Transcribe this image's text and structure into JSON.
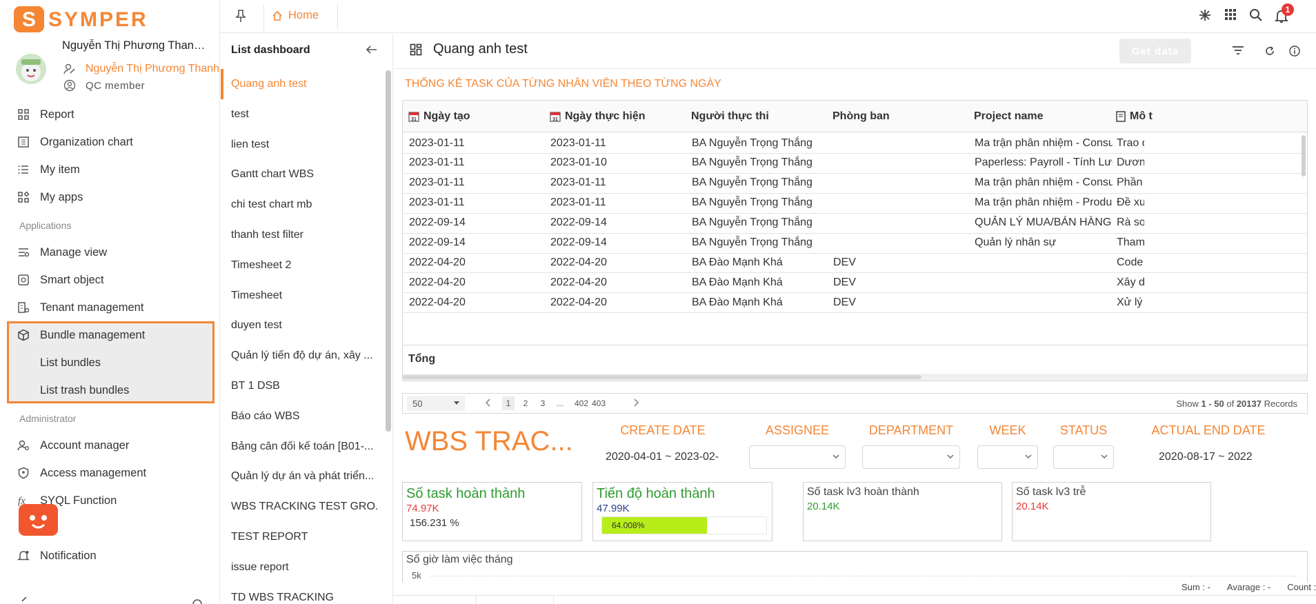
{
  "brand": {
    "logo_text": "SYMPER",
    "accent": "#f58634"
  },
  "user": {
    "name": "Nguyễn Thị Phương Thanh ...",
    "display_name": "Nguyễn Thị Phương Thanh",
    "role": "QC member"
  },
  "nav": {
    "items_top": [
      {
        "label": "Report",
        "icon": "report-icon"
      },
      {
        "label": "Organization chart",
        "icon": "org-chart-icon"
      },
      {
        "label": "My item",
        "icon": "list-icon"
      },
      {
        "label": "My apps",
        "icon": "apps-icon"
      }
    ],
    "section_applications": "Applications",
    "items_apps": [
      {
        "label": "Manage view",
        "icon": "manage-view-icon"
      },
      {
        "label": "Smart object",
        "icon": "smart-object-icon"
      },
      {
        "label": "Tenant management",
        "icon": "tenant-icon"
      },
      {
        "label": "Bundle management",
        "icon": "cube-icon"
      },
      {
        "label": "List bundles"
      },
      {
        "label": "List trash bundles"
      }
    ],
    "section_admin": "Administrator",
    "items_admin": [
      {
        "label": "Account manager",
        "icon": "account-icon"
      },
      {
        "label": "Access management",
        "icon": "shield-icon"
      },
      {
        "label": "SYQL Function",
        "icon": "function-icon"
      },
      {
        "label": "Notification",
        "icon": "bell-icon"
      }
    ]
  },
  "topbar": {
    "home_label": "Home",
    "notification_count": "1"
  },
  "list_dashboard": {
    "title": "List dashboard",
    "items": [
      "Quang anh test",
      "test",
      "lien test",
      "Gantt chart WBS",
      "chi test chart mb",
      "thanh test filter",
      "Timesheet 2",
      "Timesheet",
      "duyen test",
      "Quản lý tiến độ dự án, xây ...",
      "BT 1 DSB",
      "Báo cáo WBS",
      "Bảng cân đối kế toán [B01-...",
      "Quản lý dự án và phát triển...",
      "WBS TRACKING TEST GRO...",
      "TEST REPORT",
      "issue report",
      "TD WBS TRACKING"
    ]
  },
  "main": {
    "title": "Quang anh test",
    "get_data_label": "Get data",
    "table_title": "THỐNG KÊ TASK CỦA TỪNG NHÂN VIÊN THEO TỪNG NGÀY",
    "columns": [
      "Ngày tạo",
      "Ngày thực hiện",
      "Người thực thi",
      "Phòng ban",
      "Project name",
      "Mô t"
    ],
    "rows": [
      [
        "2023-01-11",
        "2023-01-11",
        "BA Nguyễn Trọng Thắng",
        "",
        "Ma trận phân nhiệm - Consulta...",
        "Trao đ"
      ],
      [
        "2023-01-11",
        "2023-01-10",
        "BA Nguyễn Trọng Thắng",
        "",
        "Paperless: Payroll - Tính Lương",
        "Dương"
      ],
      [
        "2023-01-11",
        "2023-01-11",
        "BA Nguyễn Trọng Thắng",
        "",
        "Ma trận phân nhiệm - Consulta...",
        "Phần l"
      ],
      [
        "2023-01-11",
        "2023-01-11",
        "BA Nguyễn Trọng Thắng",
        "",
        "Ma trận phân nhiệm - Product ...",
        "Đề xuấ"
      ],
      [
        "2022-09-14",
        "2022-09-14",
        "BA Nguyễn Trọng Thắng",
        "",
        "QUẢN LÝ MUA/BÁN HÀNG",
        "Rà soá"
      ],
      [
        "2022-09-14",
        "2022-09-14",
        "BA Nguyễn Trọng Thắng",
        "",
        "Quản lý nhân sự",
        "Tham"
      ],
      [
        "2022-04-20",
        "2022-04-20",
        "BA Đào Mạnh Khá",
        "DEV",
        "",
        "Code r"
      ],
      [
        "2022-04-20",
        "2022-04-20",
        "BA Đào Mạnh Khá",
        "DEV",
        "",
        "Xây dư"
      ],
      [
        "2022-04-20",
        "2022-04-20",
        "BA Đào Mạnh Khá",
        "DEV",
        "",
        "Xử lý l"
      ]
    ],
    "total_label": "Tổng",
    "pager": {
      "page_size": "50",
      "pages": [
        "1",
        "2",
        "3",
        "...",
        "402",
        "403"
      ],
      "show_prefix": "Show ",
      "range": "1 - 50",
      "of": " of ",
      "total": "20137",
      "records": " Records"
    },
    "wbs_title": "WBS TRAC...",
    "filters": {
      "create_date": {
        "label": "CREATE DATE",
        "value": "2020-04-01 ~ 2023-02-"
      },
      "assignee": {
        "label": "ASSIGNEE"
      },
      "department": {
        "label": "DEPARTMENT"
      },
      "week": {
        "label": "WEEK"
      },
      "status": {
        "label": "STATUS"
      },
      "actual_end_date": {
        "label": "ACTUAL END DATE",
        "value": "2020-08-17 ~ 2022"
      }
    },
    "kpis": {
      "tasks_done": {
        "label": "Số task hoàn thành",
        "value": "74.97K",
        "percent": "156.231 %"
      },
      "progress": {
        "label": "Tiến độ hoàn thành",
        "value": "47.99K",
        "bar_text": "64.008%",
        "bar_fraction": 0.64
      },
      "lv3_done": {
        "label": "Số task lv3 hoàn thành",
        "value": "20.14K"
      },
      "lv3_late": {
        "label": "Số task lv3 trễ",
        "value": "20.14K"
      }
    },
    "hours_card": {
      "label": "Số giờ làm việc tháng",
      "tick": "5k"
    },
    "footer_stats": {
      "sum": "Sum : -",
      "avg": "Avarage : -",
      "count": "Count : -"
    }
  }
}
